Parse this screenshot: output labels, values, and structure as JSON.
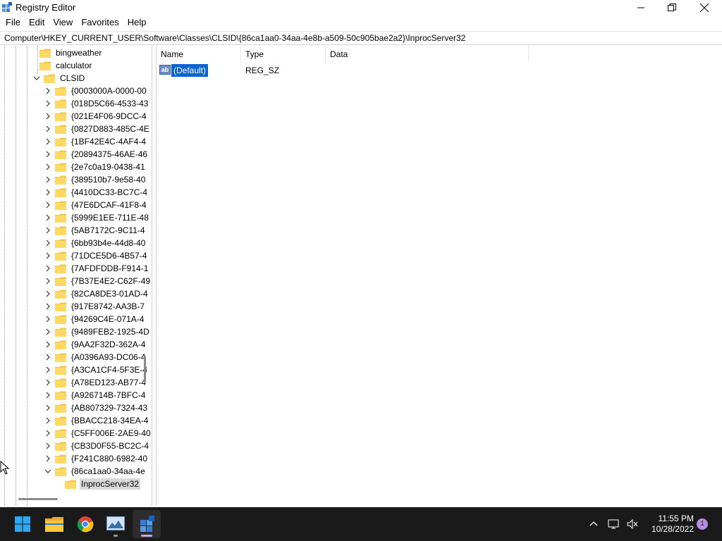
{
  "window": {
    "title": "Registry Editor",
    "controls": [
      "minimize",
      "maximize",
      "close"
    ]
  },
  "menu": [
    "File",
    "Edit",
    "View",
    "Favorites",
    "Help"
  ],
  "address": "Computer\\HKEY_CURRENT_USER\\Software\\Classes\\CLSID\\{86ca1aa0-34aa-4e8b-a509-50c905bae2a2}\\InprocServer32",
  "tree": {
    "parent_items": [
      "bingweather",
      "calculator"
    ],
    "clsid_label": "CLSID",
    "clsid_children": [
      "{0003000A-0000-00",
      "{018D5C66-4533-43",
      "{021E4F06-9DCC-4",
      "{0827D883-485C-4E",
      "{1BF42E4C-4AF4-4",
      "{20894375-46AE-46",
      "{2e7c0a19-0438-41",
      "{389510b7-9e58-40",
      "{4410DC33-BC7C-4",
      "{47E6DCAF-41F8-4",
      "{5999E1EE-711E-48",
      "{5AB7172C-9C11-4",
      "{6bb93b4e-44d8-40",
      "{71DCE5D6-4B57-4",
      "{7AFDFDDB-F914-1",
      "{7B37E4E2-C62F-49",
      "{82CA8DE3-01AD-4",
      "{917E8742-AA3B-7",
      "{94269C4E-071A-4",
      "{9489FEB2-1925-4D",
      "{9AA2F32D-362A-4",
      "{A0396A93-DC06-4",
      "{A3CA1CF4-5F3E-4",
      "{A78ED123-AB77-4",
      "{A926714B-7BFC-4",
      "{AB807329-7324-43",
      "{BBACC218-34EA-4",
      "{C5FF006E-2AE9-40",
      "{CB3D0F55-BC2C-4",
      "{F241C880-6982-40"
    ],
    "expanded_child": "{86ca1aa0-34aa-4e",
    "selected_leaf": "InprocServer32"
  },
  "list": {
    "columns": [
      "Name",
      "Type",
      "Data"
    ],
    "rows": [
      {
        "name": "(Default)",
        "type": "REG_SZ",
        "data": ""
      }
    ]
  },
  "taskbar": {
    "apps": [
      "start-button",
      "file-explorer",
      "chrome",
      "photos",
      "registry-editor"
    ],
    "active_app": "registry-editor",
    "time": "11:55 PM",
    "date": "10/28/2022",
    "notification_count": "1"
  },
  "colors": {
    "selection_blue": "#0a64d0",
    "folder_yellow": "#f5c84c",
    "taskbar": "#1a1a1a"
  }
}
